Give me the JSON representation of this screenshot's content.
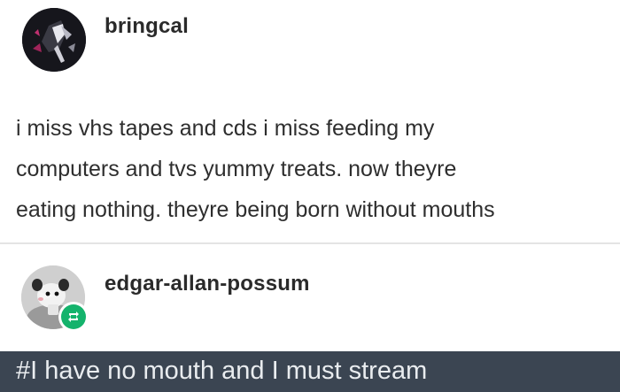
{
  "post": {
    "username": "bringcal",
    "lines": [
      "i miss vhs tapes and cds i miss feeding my",
      "computers and tvs yummy treats. now theyre",
      "eating nothing. theyre being born without mouths"
    ]
  },
  "reblog": {
    "username": "edgar-allan-possum",
    "icon": "reblog-icon",
    "accent": "#14b36c"
  },
  "tags": {
    "text": "#I have no mouth and I must stream",
    "bar_color": "#3b4552"
  }
}
